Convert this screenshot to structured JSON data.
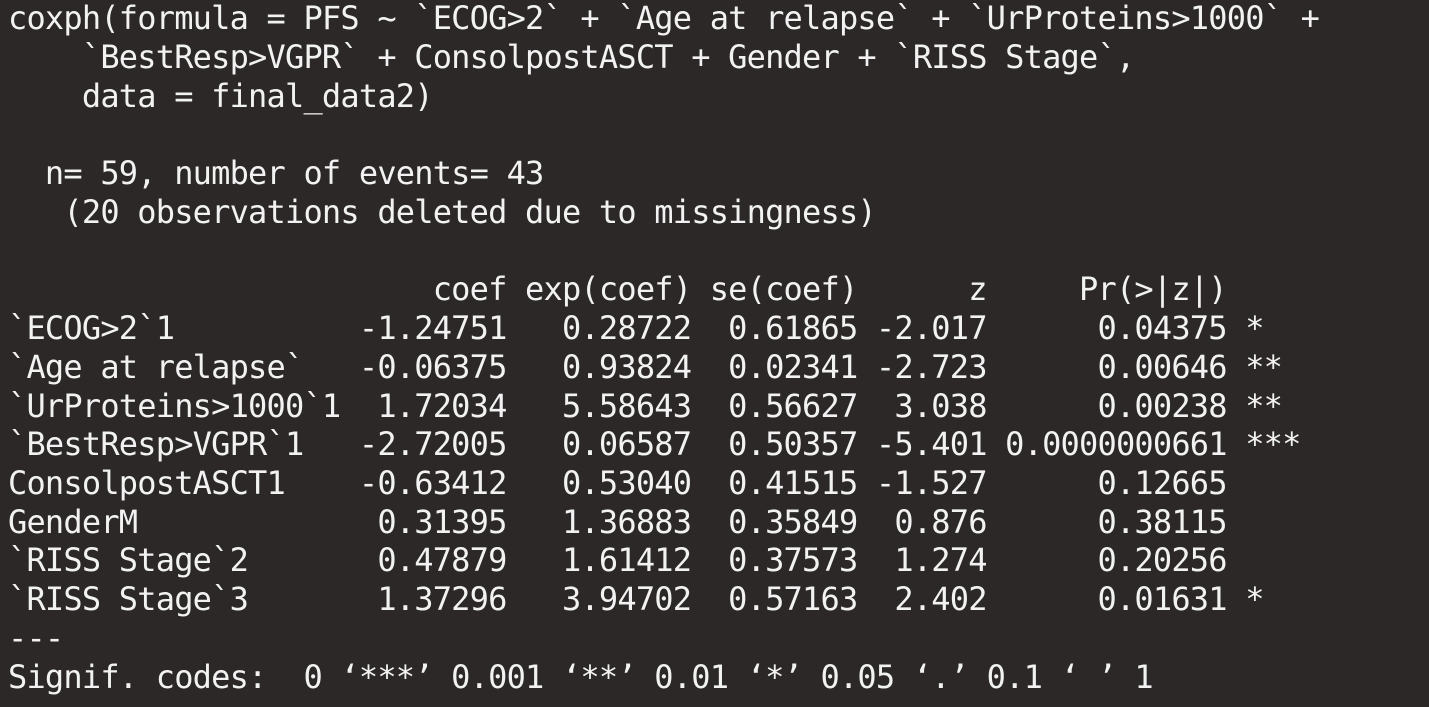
{
  "console": {
    "call": [
      "coxph(formula = PFS ~ `ECOG>2` + `Age at relapse` + `UrProteins>1000` +",
      "    `BestResp>VGPR` + ConsolpostASCT + Gender + `RISS Stage`,",
      "    data = final_data2)"
    ],
    "summary": [
      "  n= 59, number of events= 43",
      "   (20 observations deleted due to missingness)"
    ],
    "table_header": "                       coef exp(coef) se(coef)      z     Pr(>|z|)",
    "rows": [
      "`ECOG>2`1          -1.24751   0.28722  0.61865 -2.017      0.04375 *",
      "`Age at relapse`   -0.06375   0.93824  0.02341 -2.723      0.00646 **",
      "`UrProteins>1000`1  1.72034   5.58643  0.56627  3.038      0.00238 **",
      "`BestResp>VGPR`1   -2.72005   0.06587  0.50357 -5.401 0.0000000661 ***",
      "ConsolpostASCT1    -0.63412   0.53040  0.41515 -1.527      0.12665",
      "GenderM             0.31395   1.36883  0.35849  0.876      0.38115",
      "`RISS Stage`2       0.47879   1.61412  0.37573  1.274      0.20256",
      "`RISS Stage`3       1.37296   3.94702  0.57163  2.402      0.01631 *"
    ],
    "separator": "---",
    "signif_codes": "Signif. codes:  0 ‘***’ 0.001 ‘**’ 0.01 ‘*’ 0.05 ‘.’ 0.1 ‘ ’ 1"
  }
}
